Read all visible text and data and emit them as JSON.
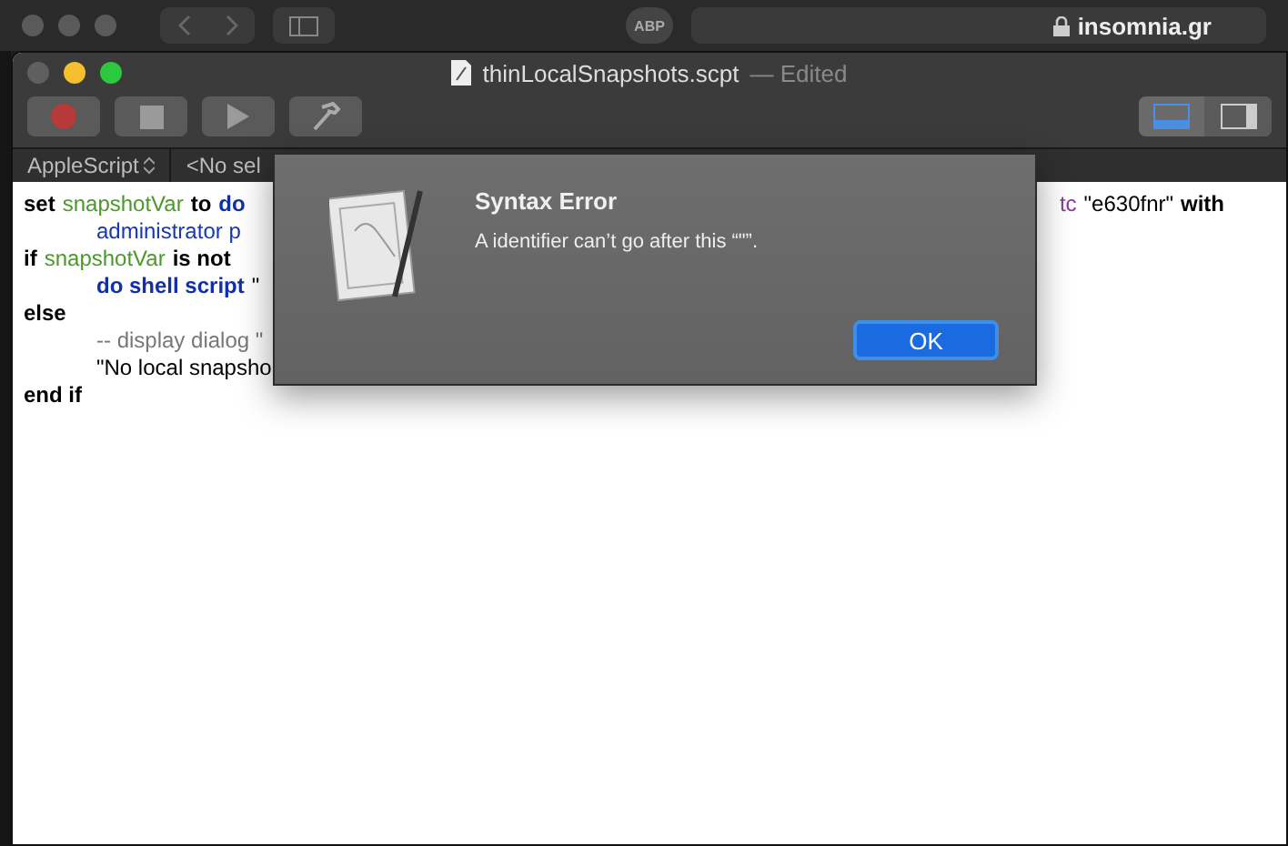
{
  "browser": {
    "address": "insomnia.gr",
    "extension_badge": "ABP"
  },
  "window": {
    "title": "thinLocalSnapshots.scpt",
    "status": "— Edited"
  },
  "toolbar": {
    "buttons": [
      {
        "kind": "record"
      },
      {
        "kind": "stop"
      },
      {
        "kind": "run"
      },
      {
        "kind": "compile"
      }
    ],
    "view_buttons": [
      {
        "kind": "bottom",
        "selected": true
      },
      {
        "kind": "side",
        "selected": false
      }
    ]
  },
  "navigation_bar": {
    "language": "AppleScript",
    "selection": "<No sel"
  },
  "code_lines": [
    {
      "indent": false,
      "tokens": [
        {
          "kind": "keyword",
          "text": "set"
        },
        {
          "kind": "variable",
          "text": "snapshotVar"
        },
        {
          "kind": "keyword",
          "text": "to"
        },
        {
          "kind": "command",
          "text": "do"
        }
      ],
      "tail": [
        {
          "kind": "parameter",
          "text": "tc"
        },
        {
          "kind": "plain",
          "text": "\"e630fnr\""
        },
        {
          "kind": "keyword",
          "text": "with"
        }
      ]
    },
    {
      "indent": true,
      "tokens": [
        {
          "kind": "parameter",
          "text": "administrator p"
        }
      ]
    },
    {
      "indent": false,
      "tokens": [
        {
          "kind": "keyword",
          "text": "if"
        },
        {
          "kind": "variable",
          "text": "snapshotVar"
        },
        {
          "kind": "keyword",
          "text": "is not"
        }
      ]
    },
    {
      "indent": true,
      "tokens": [
        {
          "kind": "command",
          "text": "do shell script"
        },
        {
          "kind": "plain",
          "text": "\""
        }
      ]
    },
    {
      "indent": false,
      "tokens": [
        {
          "kind": "keyword",
          "text": "else"
        }
      ]
    },
    {
      "indent": true,
      "tokens": [
        {
          "kind": "comment",
          "text": "-- display dialog \""
        }
      ]
    },
    {
      "indent": true,
      "tokens": [
        {
          "kind": "plain",
          "text": "\"No local snapsho"
        }
      ]
    },
    {
      "indent": false,
      "tokens": [
        {
          "kind": "keyword",
          "text": "end if"
        }
      ]
    }
  ],
  "dialog": {
    "title": "Syntax Error",
    "message": "A identifier can’t go after this “\"”.",
    "button": "OK"
  }
}
